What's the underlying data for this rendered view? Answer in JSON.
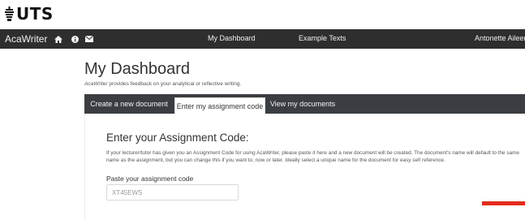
{
  "logo": {
    "text": "UTS"
  },
  "navbar": {
    "brand": "AcaWriter",
    "icons": [
      "home-icon",
      "info-icon",
      "envelope-icon"
    ],
    "links": [
      "My Dashboard",
      "Example Texts"
    ],
    "user": "Antonette Aileen"
  },
  "page": {
    "title": "My Dashboard",
    "subtitle_brand": "AcaWriter",
    "subtitle_rest": " provides feedback on your analytical or reflective writing."
  },
  "tabs": {
    "create": "Create a new document",
    "enter": "Enter my assignment code",
    "view": "View my documents",
    "active": "enter"
  },
  "panel": {
    "heading": "Enter your Assignment Code:",
    "help": "If your lecturer/tutor has given you an Assignment Code for using AcaWriter, please paste it here and a new document will be created. The document's name will default to the same name as the assignment, but you can change this if you want to, now or later. Ideally select a unique name for the document for easy self reference.",
    "field_label": "Paste your assignment code",
    "field_value": "XT45EWS"
  },
  "colors": {
    "navbar": "#2e2e2e",
    "tabbar": "#3a3e42",
    "accent_red": "#e32b1c"
  }
}
